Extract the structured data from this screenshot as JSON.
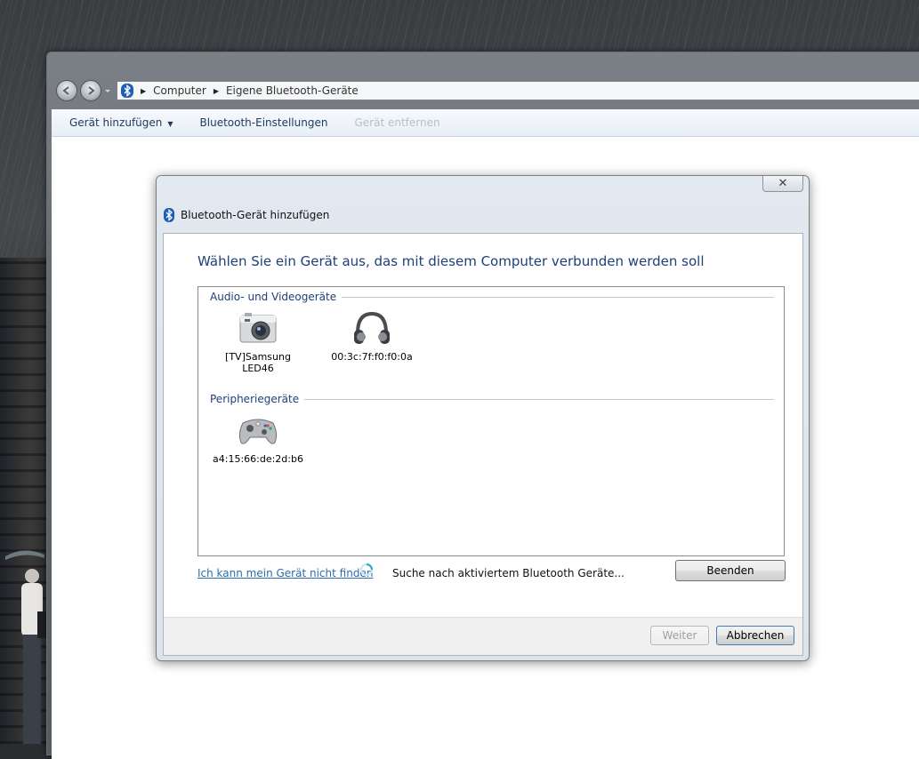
{
  "explorer": {
    "breadcrumbs": [
      "Computer",
      "Eigene Bluetooth-Geräte"
    ],
    "toolbar": {
      "add_device": "Gerät hinzufügen",
      "bluetooth_settings": "Bluetooth-Einstellungen",
      "remove_device": "Gerät entfernen"
    }
  },
  "dialog": {
    "title": "Bluetooth-Gerät hinzufügen",
    "close_glyph": "✕",
    "heading": "Wählen Sie ein Gerät aus, das mit diesem Computer verbunden werden soll",
    "groups": [
      {
        "label": "Audio- und Videogeräte",
        "devices": [
          {
            "label": "[TV]Samsung LED46",
            "icon": "camera-icon"
          },
          {
            "label": "00:3c:7f:f0:f0:0a",
            "icon": "headphones-icon"
          }
        ]
      },
      {
        "label": "Peripheriegeräte",
        "devices": [
          {
            "label": "a4:15:66:de:2d:b6",
            "icon": "gamepad-icon"
          }
        ]
      }
    ],
    "help_link": "Ich kann mein Gerät nicht finden",
    "status": "Suche nach aktiviertem Bluetooth Geräte...",
    "stop_button": "Beenden",
    "next_button": "Weiter",
    "cancel_button": "Abbrechen"
  },
  "colors": {
    "heading": "#1e3f7a",
    "link": "#2b6cb0",
    "toolbar_text": "#1e395b",
    "disabled_text": "#b8bfc8"
  }
}
